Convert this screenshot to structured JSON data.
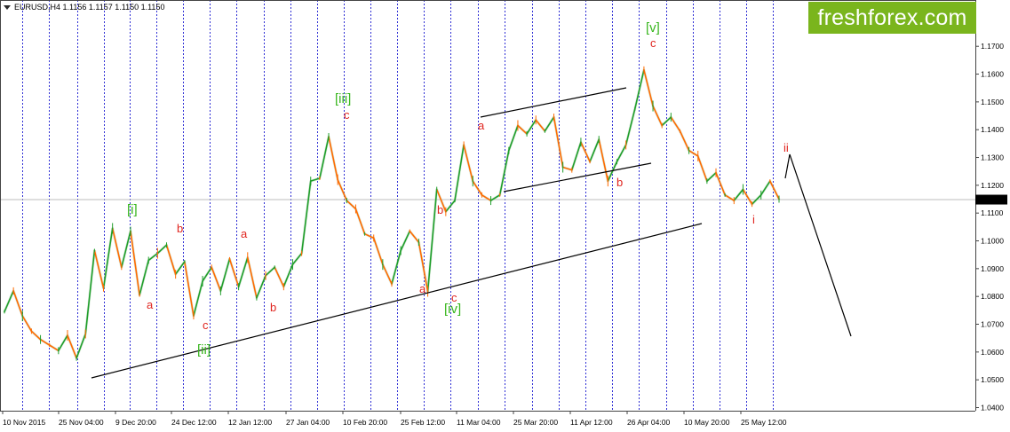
{
  "app": {
    "symbol_header": "EURUSD,H4  1.1156 1.1157 1.1150 1.1150",
    "brand": "freshforex.com"
  },
  "colors": {
    "background": "#ffffff",
    "grid": "#2f2fd5",
    "axis": "#444444",
    "price_line": "#bdbdbd",
    "price_box": "#000000",
    "price_text": "#ffffff",
    "wave_green": "#37b61d",
    "wave_red": "#e0251f",
    "bull": "#1f9e2b",
    "bear": "#ff6a00",
    "trendline": "#000000",
    "logo_bg": "#7ab51d"
  },
  "chart_data": {
    "type": "line",
    "title": "",
    "ylim": [
      1.04,
      1.175
    ],
    "y_ticks": [
      "1.1700",
      "1.1600",
      "1.1500",
      "1.1400",
      "1.1300",
      "1.1200",
      "1.1100",
      "1.1000",
      "1.0900",
      "1.0800",
      "1.0700",
      "1.0600",
      "1.0500",
      "1.0400"
    ],
    "x_ticks": [
      "10 Nov 2015",
      "25 Nov 04:00",
      "9 Dec 20:00",
      "24 Dec 12:00",
      "12 Jan 12:00",
      "27 Jan 04:00",
      "10 Feb 20:00",
      "25 Feb 12:00",
      "11 Mar 04:00",
      "25 Mar 20:00",
      "11 Apr 12:00",
      "26 Apr 04:00",
      "10 May 20:00",
      "25 May 12:00"
    ],
    "current_price": "1.1150",
    "series": [
      {
        "points": [
          {
            "x": 0,
            "y": 1.0745
          },
          {
            "x": 1,
            "y": 1.082
          },
          {
            "x": 2,
            "y": 1.073
          },
          {
            "x": 3,
            "y": 1.0675
          },
          {
            "x": 4,
            "y": 1.0645
          },
          {
            "x": 5,
            "y": 1.0625
          },
          {
            "x": 6,
            "y": 1.0605
          },
          {
            "x": 7,
            "y": 1.066
          },
          {
            "x": 8,
            "y": 1.0578
          },
          {
            "x": 9,
            "y": 1.0665
          },
          {
            "x": 10,
            "y": 1.0965
          },
          {
            "x": 11,
            "y": 1.083
          },
          {
            "x": 12,
            "y": 1.1045
          },
          {
            "x": 13,
            "y": 1.0905
          },
          {
            "x": 14,
            "y": 1.1035
          },
          {
            "x": 15,
            "y": 1.0805
          },
          {
            "x": 16,
            "y": 1.093
          },
          {
            "x": 17,
            "y": 1.0955
          },
          {
            "x": 18,
            "y": 1.0985
          },
          {
            "x": 19,
            "y": 1.088
          },
          {
            "x": 20,
            "y": 1.0925
          },
          {
            "x": 21,
            "y": 1.073
          },
          {
            "x": 22,
            "y": 1.0855
          },
          {
            "x": 23,
            "y": 1.0905
          },
          {
            "x": 24,
            "y": 1.082
          },
          {
            "x": 25,
            "y": 1.0935
          },
          {
            "x": 26,
            "y": 1.0835
          },
          {
            "x": 27,
            "y": 1.094
          },
          {
            "x": 28,
            "y": 1.0795
          },
          {
            "x": 29,
            "y": 1.0875
          },
          {
            "x": 30,
            "y": 1.0905
          },
          {
            "x": 31,
            "y": 1.0835
          },
          {
            "x": 32,
            "y": 1.0915
          },
          {
            "x": 33,
            "y": 1.0955
          },
          {
            "x": 34,
            "y": 1.1215
          },
          {
            "x": 35,
            "y": 1.1225
          },
          {
            "x": 36,
            "y": 1.1375
          },
          {
            "x": 37,
            "y": 1.122
          },
          {
            "x": 38,
            "y": 1.1145
          },
          {
            "x": 39,
            "y": 1.1115
          },
          {
            "x": 40,
            "y": 1.1025
          },
          {
            "x": 41,
            "y": 1.101
          },
          {
            "x": 42,
            "y": 1.0915
          },
          {
            "x": 43,
            "y": 1.0845
          },
          {
            "x": 44,
            "y": 1.0965
          },
          {
            "x": 45,
            "y": 1.1035
          },
          {
            "x": 46,
            "y": 1.0995
          },
          {
            "x": 47,
            "y": 1.0818
          },
          {
            "x": 48,
            "y": 1.1185
          },
          {
            "x": 49,
            "y": 1.1105
          },
          {
            "x": 50,
            "y": 1.1145
          },
          {
            "x": 51,
            "y": 1.1345
          },
          {
            "x": 52,
            "y": 1.1215
          },
          {
            "x": 53,
            "y": 1.1165
          },
          {
            "x": 54,
            "y": 1.1145
          },
          {
            "x": 55,
            "y": 1.1165
          },
          {
            "x": 56,
            "y": 1.1325
          },
          {
            "x": 57,
            "y": 1.1415
          },
          {
            "x": 58,
            "y": 1.1385
          },
          {
            "x": 59,
            "y": 1.1435
          },
          {
            "x": 60,
            "y": 1.1395
          },
          {
            "x": 61,
            "y": 1.1445
          },
          {
            "x": 62,
            "y": 1.1265
          },
          {
            "x": 63,
            "y": 1.1255
          },
          {
            "x": 64,
            "y": 1.1355
          },
          {
            "x": 65,
            "y": 1.1285
          },
          {
            "x": 66,
            "y": 1.1365
          },
          {
            "x": 67,
            "y": 1.1215
          },
          {
            "x": 68,
            "y": 1.1285
          },
          {
            "x": 69,
            "y": 1.1345
          },
          {
            "x": 70,
            "y": 1.1475
          },
          {
            "x": 71,
            "y": 1.1615
          },
          {
            "x": 72,
            "y": 1.1485
          },
          {
            "x": 73,
            "y": 1.1415
          },
          {
            "x": 74,
            "y": 1.1445
          },
          {
            "x": 75,
            "y": 1.1395
          },
          {
            "x": 76,
            "y": 1.1325
          },
          {
            "x": 77,
            "y": 1.1305
          },
          {
            "x": 78,
            "y": 1.1215
          },
          {
            "x": 79,
            "y": 1.1245
          },
          {
            "x": 80,
            "y": 1.1165
          },
          {
            "x": 81,
            "y": 1.1145
          },
          {
            "x": 82,
            "y": 1.1185
          },
          {
            "x": 83,
            "y": 1.1132
          },
          {
            "x": 84,
            "y": 1.1165
          },
          {
            "x": 85,
            "y": 1.1215
          },
          {
            "x": 86,
            "y": 1.115
          }
        ]
      }
    ]
  },
  "annotations": {
    "waves": [
      {
        "label": "[i]",
        "color": "green"
      },
      {
        "label": "[ii]",
        "color": "green"
      },
      {
        "label": "[iii]",
        "color": "green"
      },
      {
        "label": "[iv]",
        "color": "green"
      },
      {
        "label": "[v]",
        "color": "green"
      },
      {
        "label": "a",
        "color": "red"
      },
      {
        "label": "b",
        "color": "red"
      },
      {
        "label": "c",
        "color": "red"
      },
      {
        "label": "a",
        "color": "red"
      },
      {
        "label": "b",
        "color": "red"
      },
      {
        "label": "c",
        "color": "red"
      },
      {
        "label": "c",
        "color": "red"
      },
      {
        "label": "a",
        "color": "red"
      },
      {
        "label": "b",
        "color": "red"
      },
      {
        "label": "c",
        "color": "red"
      },
      {
        "label": "a",
        "color": "red"
      },
      {
        "label": "b",
        "color": "red"
      },
      {
        "label": "c",
        "color": "red"
      },
      {
        "label": "i",
        "color": "red"
      },
      {
        "label": "ii",
        "color": "red"
      }
    ]
  }
}
